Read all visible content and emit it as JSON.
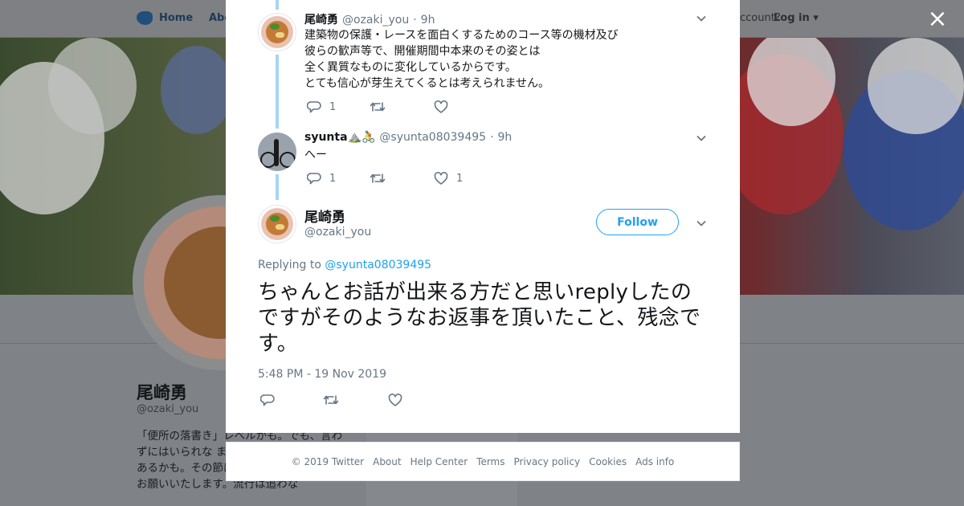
{
  "background": {
    "nav": {
      "home": "Home",
      "about": "Abo",
      "account_prompt": "ccount?",
      "login": "Log in"
    },
    "profile": {
      "name": "尾崎勇",
      "handle": "@ozaki_you",
      "bio": "「便所の落書き」レベルかも。でも、言わずにはいられな ました。基本是々 違いがあるかも。その節はご指導ご鞭撻 のほどお願いいたします。流行は追わな",
      "ads_info": "Ads info"
    }
  },
  "modal": {
    "close_label": "×",
    "tweets": [
      {
        "name": "尾崎勇",
        "handle": "@ozaki_you",
        "separator": "·",
        "time": "9h",
        "lines": [
          "建築物の保護・レースを面白くするためのコース等の機材及び",
          "彼らの歓声等で、開催期間中本来のその姿とは",
          "全く異質なものに変化しているからです。",
          "とても信心が芽生えてくるとは考えられません。"
        ],
        "replies": "1",
        "retweets": "",
        "likes": ""
      },
      {
        "name": "syunta⛰️🚴",
        "handle": "@syunta08039495",
        "separator": "·",
        "time": "9h",
        "lines": [
          "へー"
        ],
        "replies": "1",
        "retweets": "",
        "likes": "1"
      }
    ],
    "main_tweet": {
      "name": "尾崎勇",
      "handle": "@ozaki_you",
      "follow_label": "Follow",
      "replying_prefix": "Replying to",
      "replying_to": "@syunta08039495",
      "text": "ちゃんとお話が出来る方だと思いreplyしたのですがそのようなお返事を頂いたこと、残念です。",
      "timestamp": "5:48 PM - 19 Nov 2019"
    }
  },
  "footer": {
    "links": [
      "© 2019 Twitter",
      "About",
      "Help Center",
      "Terms",
      "Privacy policy",
      "Cookies",
      "Ads info"
    ]
  },
  "colors": {
    "accent": "#1da1f2",
    "muted": "#657786",
    "thread_line": "#a8d4f2",
    "overlay": "#7f8387"
  },
  "icons": [
    "twitter-bird-icon",
    "close-icon",
    "chevron-down-icon",
    "reply-icon",
    "retweet-icon",
    "like-icon"
  ]
}
